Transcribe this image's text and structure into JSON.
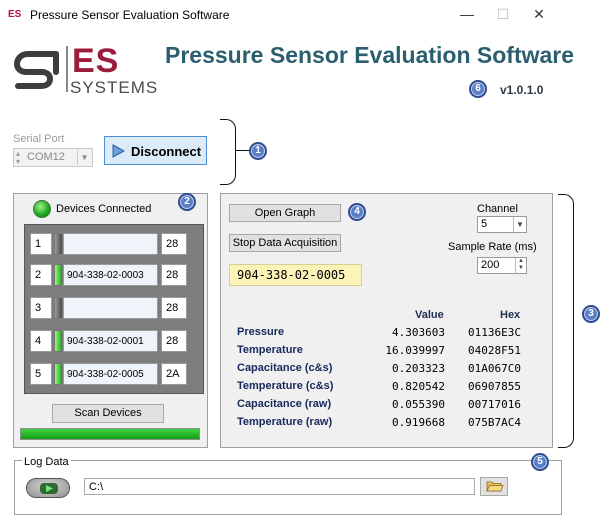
{
  "window": {
    "icon_text": "ES",
    "title": "Pressure Sensor Evaluation Software",
    "minimize": "—",
    "maximize": "☐",
    "close": "✕"
  },
  "header": {
    "logo_es": "ES",
    "logo_systems": "SYSTEMS",
    "app_title": "Pressure Sensor Evaluation Software",
    "version": "v1.0.1.0"
  },
  "badges": [
    "1",
    "2",
    "3",
    "4",
    "5",
    "6"
  ],
  "serial": {
    "label": "Serial Port",
    "com_value": "COM12",
    "disconnect_label": "Disconnect"
  },
  "devices": {
    "title": "Devices Connected",
    "rows": [
      {
        "num": "1",
        "name": "",
        "addr": "28",
        "active": false
      },
      {
        "num": "2",
        "name": "904-338-02-0003",
        "addr": "28",
        "active": true
      },
      {
        "num": "3",
        "name": "",
        "addr": "28",
        "active": false
      },
      {
        "num": "4",
        "name": "904-338-02-0001",
        "addr": "28",
        "active": true
      },
      {
        "num": "5",
        "name": "904-338-02-0005",
        "addr": "2A",
        "active": true
      }
    ],
    "scan_label": "Scan Devices",
    "scan_progress": 1.0
  },
  "acquisition": {
    "open_graph_label": "Open Graph",
    "stop_label": "Stop Data Acquisition",
    "serial_display": "904-338-02-0005",
    "channel_label": "Channel",
    "channel_value": "5",
    "sample_rate_label": "Sample Rate (ms)",
    "sample_rate_value": "200",
    "col_value": "Value",
    "col_hex": "Hex",
    "measurements": [
      {
        "label": "Pressure",
        "value": "4.303603",
        "hex": "01136E3C"
      },
      {
        "label": "Temperature",
        "value": "16.039997",
        "hex": "04028F51"
      },
      {
        "label": "Capacitance (c&s)",
        "value": "0.203323",
        "hex": "01A067C0"
      },
      {
        "label": "Temperature (c&s)",
        "value": "0.820542",
        "hex": "06907855"
      },
      {
        "label": "Capacitance (raw)",
        "value": "0.055390",
        "hex": "00717016"
      },
      {
        "label": "Temperature (raw)",
        "value": "0.919668",
        "hex": "075B7AC4"
      }
    ]
  },
  "log": {
    "title": "Log Data",
    "path": "C:\\"
  },
  "colors": {
    "accent": "#2b5f6f",
    "brand": "#9b1b3a",
    "led_green": "#1aa51a",
    "badge": "#5b7fc7",
    "serial_display_bg": "#fbf3b8"
  }
}
